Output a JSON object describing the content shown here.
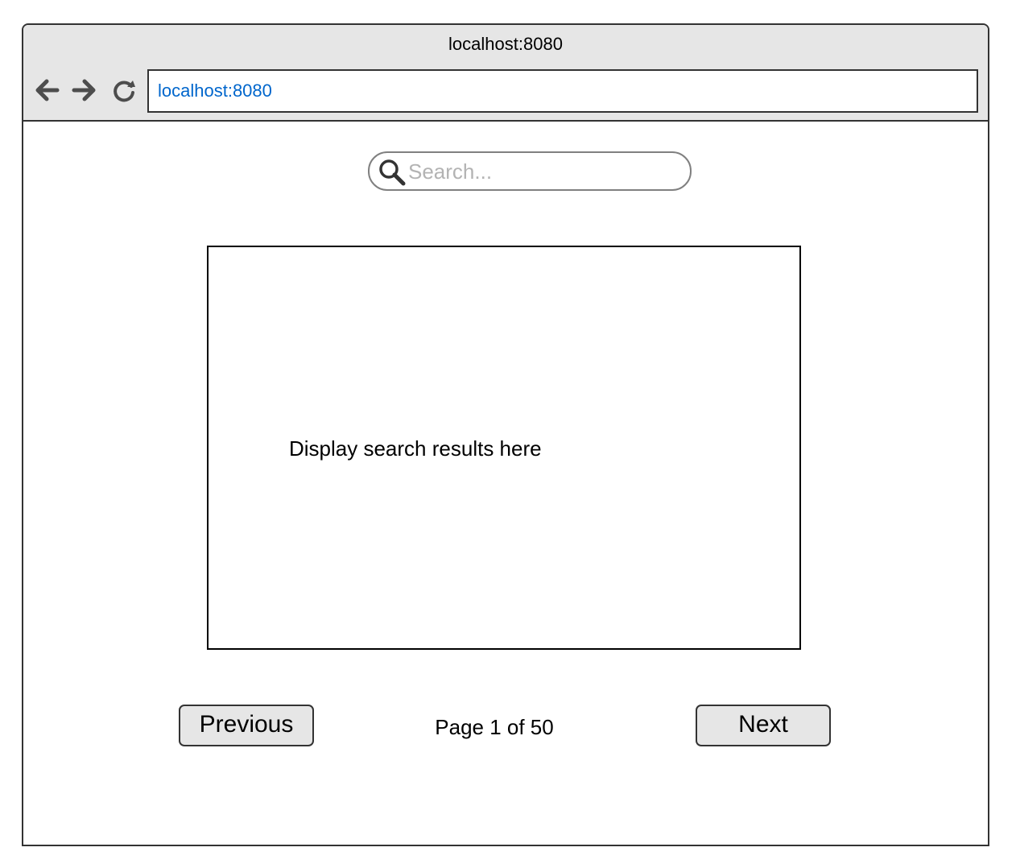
{
  "window": {
    "title": "localhost:8080"
  },
  "toolbar": {
    "back_icon": "arrow-left-icon",
    "forward_icon": "arrow-right-icon",
    "reload_icon": "reload-icon",
    "address": "localhost:8080"
  },
  "search": {
    "placeholder": "Search...",
    "value": "",
    "icon": "search-icon"
  },
  "results": {
    "text": "Display search results here"
  },
  "pagination": {
    "previous_label": "Previous",
    "next_label": "Next",
    "page_text": "Page 1 of 50"
  },
  "colors": {
    "chrome_bg": "#e6e6e6",
    "address_text": "#0066cc",
    "placeholder": "#b3b3b3",
    "button_bg": "#e6e6e6",
    "border": "#333333"
  }
}
